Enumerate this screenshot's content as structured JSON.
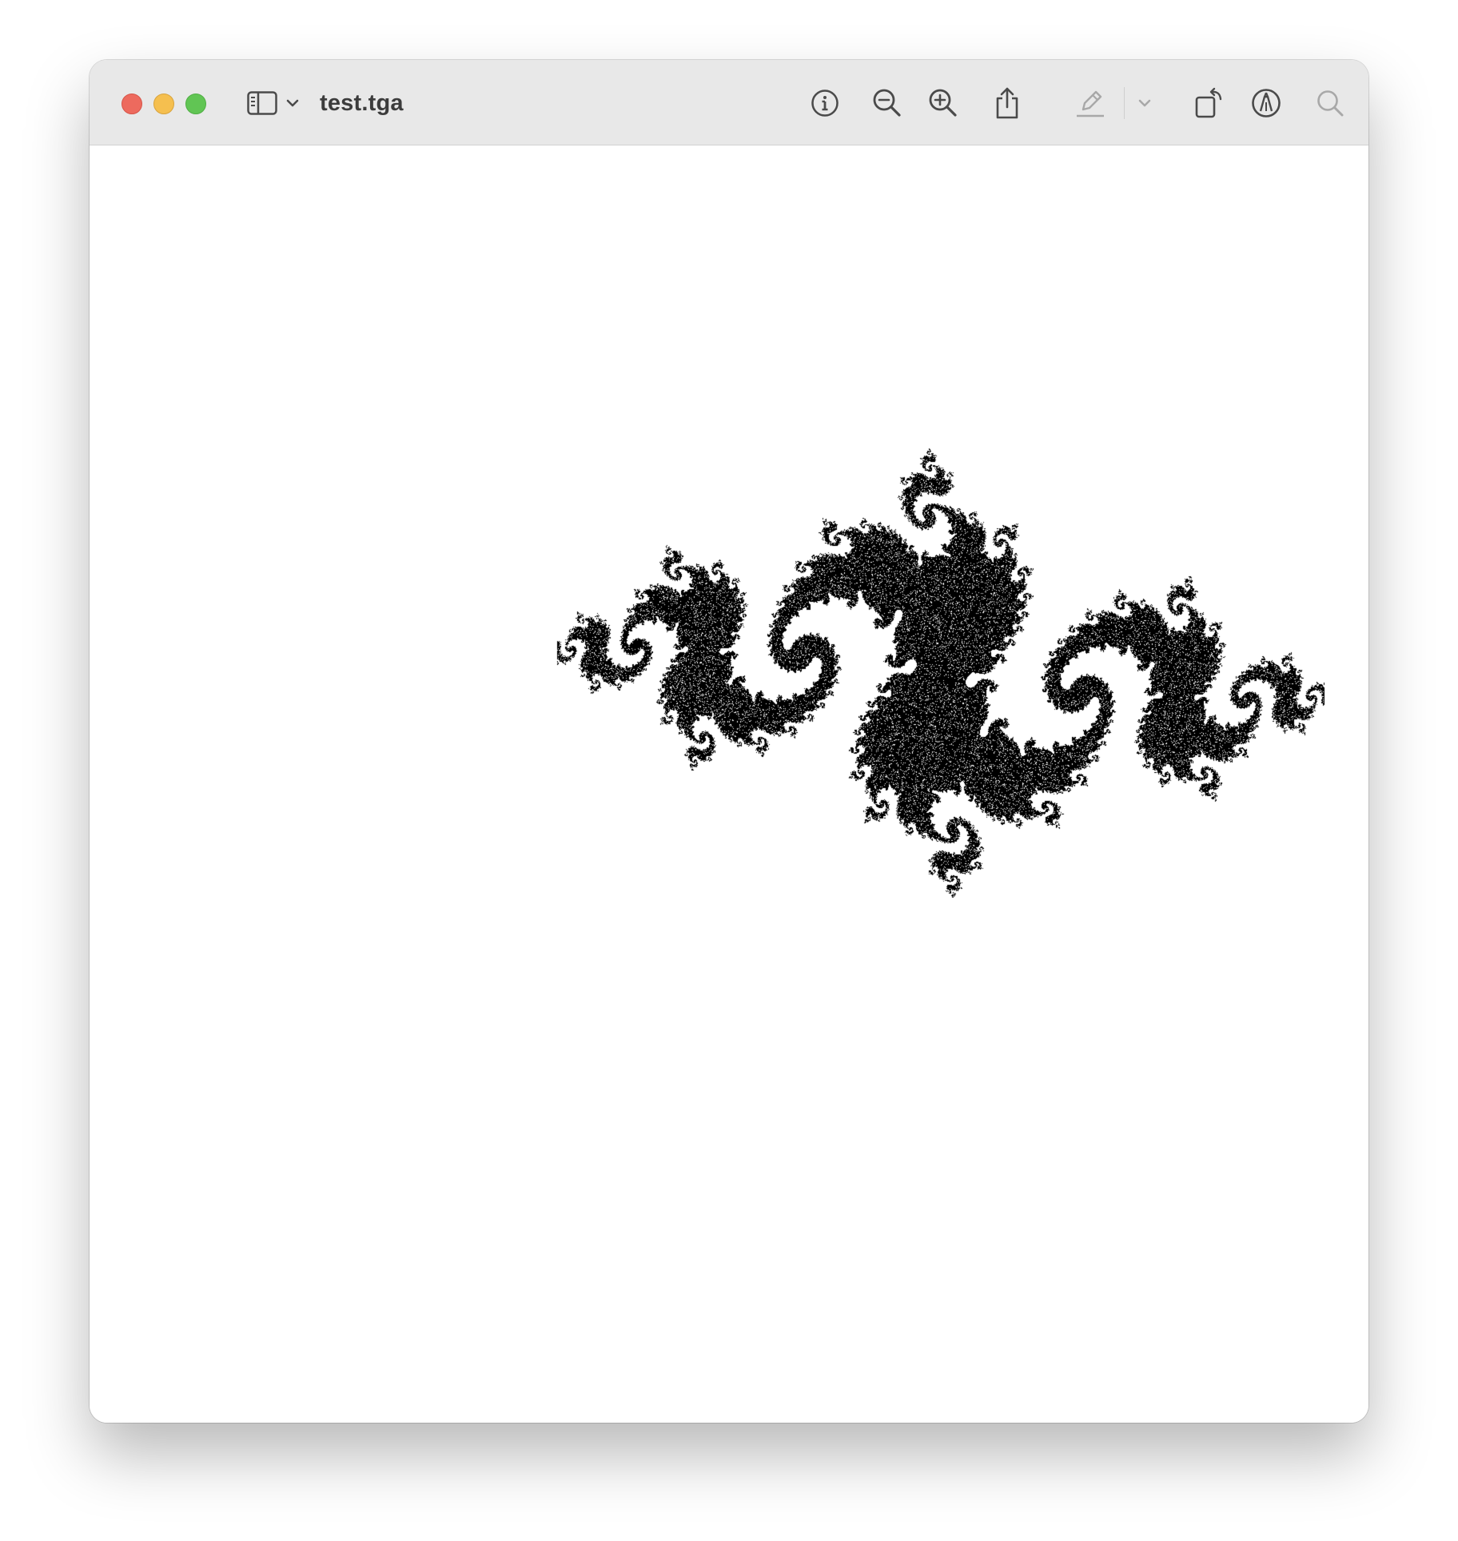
{
  "window": {
    "title": "test.tga"
  },
  "toolbar": {
    "items": [
      {
        "name": "sidebar-toggle",
        "icon": "sidebar-icon"
      },
      {
        "name": "sidebar-menu",
        "icon": "chevron-down-icon"
      },
      {
        "name": "info",
        "icon": "info-icon"
      },
      {
        "name": "zoom-out",
        "icon": "zoom-out-icon"
      },
      {
        "name": "zoom-in",
        "icon": "zoom-in-icon"
      },
      {
        "name": "share",
        "icon": "share-icon"
      },
      {
        "name": "highlight",
        "icon": "pencil-icon"
      },
      {
        "name": "highlight-menu",
        "icon": "chevron-down-icon"
      },
      {
        "name": "rotate",
        "icon": "rotate-icon"
      },
      {
        "name": "markup",
        "icon": "markup-icon"
      },
      {
        "name": "search",
        "icon": "search-icon"
      }
    ]
  },
  "colors": {
    "close": "#ed6a5e",
    "minimize": "#f5bf4f",
    "maximize": "#61c554",
    "titlebar": "#e8e8e8",
    "icon": "#4a4a4a",
    "icon_disabled": "#a8a8a8",
    "fractal": "#000000"
  },
  "content": {
    "image": "julia-set-fractal"
  }
}
